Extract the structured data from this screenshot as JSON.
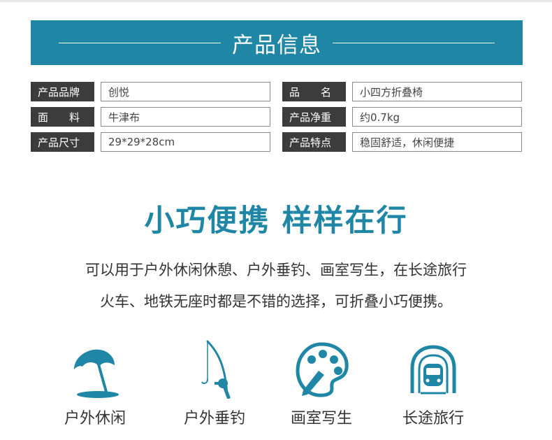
{
  "banner": {
    "title": "产品信息"
  },
  "specs": [
    {
      "label": "产品品牌",
      "value": "创悦"
    },
    {
      "label": "品　　名",
      "value": "小四方折叠椅"
    },
    {
      "label": "面　　料",
      "value": "牛津布"
    },
    {
      "label": "产品净重",
      "value": "约0.7kg"
    },
    {
      "label": "产品尺寸",
      "value": "29*29*28cm"
    },
    {
      "label": "产品特点",
      "value": "稳固舒适，休闲便捷"
    }
  ],
  "headline": "小巧便携 样样在行",
  "description": [
    "可以用于户外休闲休憩、户外垂钓、画室写生，在长途旅行",
    "火车、地铁无座时都是不错的选择，可折叠小巧便携。"
  ],
  "features": [
    {
      "icon": "beach-umbrella-icon",
      "label": "户外休闲"
    },
    {
      "icon": "fishing-rod-icon",
      "label": "户外垂钓"
    },
    {
      "icon": "paint-palette-icon",
      "label": "画室写生"
    },
    {
      "icon": "train-tunnel-icon",
      "label": "长途旅行"
    }
  ],
  "colors": {
    "accent": "#1f86a5",
    "label_bg": "#3c3c3c"
  }
}
